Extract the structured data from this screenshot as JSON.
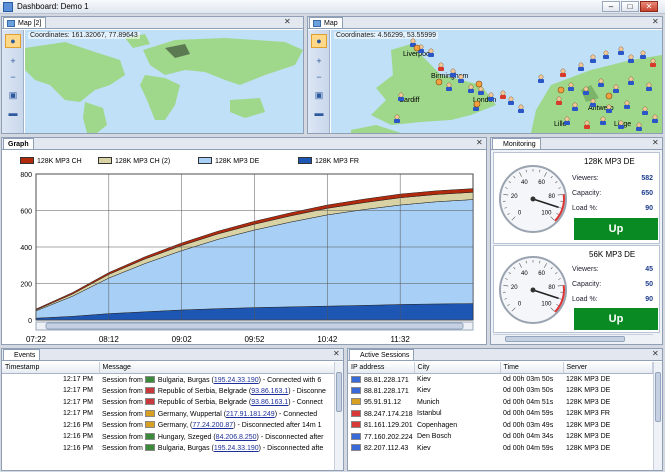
{
  "window": {
    "title": "Dashboard: Demo 1",
    "min": "–",
    "max": "□",
    "close": "✕"
  },
  "map1": {
    "tab": "Map [2]",
    "coords": "Coordinates: 161.32067, 77.89643"
  },
  "map2": {
    "tab": "Map",
    "coords": "Coordinates: 4.56299, 53.55999",
    "cities": [
      "Liverpool",
      "Birmingham",
      "Cardiff",
      "London",
      "Antwerp",
      "Lille",
      "Liege"
    ]
  },
  "graph": {
    "tab": "Graph",
    "legend": [
      {
        "name": "128K MP3 CH",
        "color": "#b22a0e"
      },
      {
        "name": "128K MP3 CH (2)",
        "color": "#d8d2a4"
      },
      {
        "name": "128K MP3 DE",
        "color": "#a8cff5"
      },
      {
        "name": "128K MP3 FR",
        "color": "#1e56b4"
      }
    ]
  },
  "chart_data": {
    "type": "area",
    "stacked": true,
    "x": [
      "07:22",
      "07:47",
      "08:12",
      "08:37",
      "09:02",
      "09:27",
      "09:52",
      "10:17",
      "10:42",
      "11:07",
      "11:32",
      "11:57",
      "12:17"
    ],
    "series": [
      {
        "name": "128K MP3 FR",
        "values": [
          10,
          20,
          35,
          45,
          55,
          62,
          68,
          72,
          76,
          80,
          85,
          88,
          90
        ]
      },
      {
        "name": "128K MP3 DE",
        "values": [
          40,
          110,
          195,
          265,
          325,
          380,
          425,
          465,
          500,
          525,
          545,
          560,
          570
        ]
      },
      {
        "name": "128K MP3 CH (2)",
        "values": [
          5,
          12,
          20,
          25,
          28,
          30,
          32,
          34,
          36,
          38,
          40,
          40,
          40
        ]
      },
      {
        "name": "128K MP3 CH",
        "values": [
          5,
          8,
          10,
          12,
          14,
          15,
          16,
          17,
          18,
          19,
          20,
          20,
          20
        ]
      }
    ],
    "yticks": [
      0,
      200,
      400,
      600,
      800
    ],
    "xticks": [
      "07:22",
      "08:12",
      "09:02",
      "09:52",
      "10:42",
      "11:32"
    ],
    "ylim": [
      0,
      800
    ],
    "grid": true,
    "legend": "top-left"
  },
  "monitoring": {
    "tab": "Monitoring",
    "cards": [
      {
        "title": "128K MP3 DE",
        "viewers_label": "Viewers:",
        "viewers": "582",
        "capacity_label": "Capacity:",
        "capacity": "650",
        "load_label": "Load %:",
        "load": "90",
        "status": "Up",
        "gauge_level": 0.9
      },
      {
        "title": "56K MP3 DE",
        "viewers_label": "Viewers:",
        "viewers": "45",
        "capacity_label": "Capacity:",
        "capacity": "50",
        "load_label": "Load %:",
        "load": "90",
        "status": "Up",
        "gauge_level": 0.9
      }
    ],
    "gauge_ticks": [
      "0",
      "20",
      "40",
      "60",
      "80",
      "100"
    ]
  },
  "events": {
    "tab": "Events",
    "columns": [
      "Timestamp",
      "Message"
    ],
    "rows": [
      {
        "time": "12:17 PM",
        "prefix": "Session from",
        "place": "Bulgaria, Burgas",
        "ip": "195.24.33.190",
        "msg": "- Connected with 6",
        "flag": "#3a8a3a"
      },
      {
        "time": "12:17 PM",
        "prefix": "Session from",
        "place": "Republic of Serbia, Belgrade",
        "ip": "93.86.163.1",
        "msg": "- Disconne",
        "flag": "#c83a3a"
      },
      {
        "time": "12:17 PM",
        "prefix": "Session from",
        "place": "Republic of Serbia, Belgrade",
        "ip": "93.86.163.1",
        "msg": "- Connect",
        "flag": "#c83a3a"
      },
      {
        "time": "12:17 PM",
        "prefix": "Session from",
        "place": "Germany, Wuppertal",
        "ip": "217.91.181.249",
        "msg": "- Connected",
        "flag": "#d8a020"
      },
      {
        "time": "12:16 PM",
        "prefix": "Session from",
        "place": "Germany,",
        "ip": "77.24.200.87",
        "msg": "- Disconnected after 14m 1",
        "flag": "#d8a020"
      },
      {
        "time": "12:16 PM",
        "prefix": "Session from",
        "place": "Hungary, Szeged",
        "ip": "84.206.8.250",
        "msg": "- Disconnected after",
        "flag": "#3a8a3a"
      },
      {
        "time": "12:16 PM",
        "prefix": "Session from",
        "place": "Bulgaria, Burgas",
        "ip": "195.24.33.190",
        "msg": "- Disconnected afte",
        "flag": "#3a8a3a"
      }
    ]
  },
  "sessions": {
    "tab": "Active Sessions",
    "columns": [
      "IP address",
      "City",
      "Time",
      "Server"
    ],
    "rows": [
      {
        "ip": "88.81.228.171",
        "city": "Kiev",
        "time": "0d 00h 03m 50s",
        "server": "128K MP3 DE",
        "flag": "#3a6ad8"
      },
      {
        "ip": "88.81.228.171",
        "city": "Kiev",
        "time": "0d 00h 03m 50s",
        "server": "128K MP3 DE",
        "flag": "#3a6ad8"
      },
      {
        "ip": "95.91.91.12",
        "city": "Munich",
        "time": "0d 00h 04m 51s",
        "server": "128K MP3 DE",
        "flag": "#d8a020"
      },
      {
        "ip": "88.247.174.218",
        "city": "Istanbul",
        "time": "0d 00h 04m 59s",
        "server": "128K MP3 FR",
        "flag": "#d83a3a"
      },
      {
        "ip": "81.161.129.201",
        "city": "Copenhagen",
        "time": "0d 00h 03m 49s",
        "server": "128K MP3 DE",
        "flag": "#d83a3a"
      },
      {
        "ip": "77.160.202.224",
        "city": "Den Bosch",
        "time": "0d 00h 04m 34s",
        "server": "128K MP3 DE",
        "flag": "#3a6ad8"
      },
      {
        "ip": "82.207.112.43",
        "city": "Kiev",
        "time": "0d 00h 04m 59s",
        "server": "128K MP3 DE",
        "flag": "#3a6ad8"
      }
    ]
  }
}
